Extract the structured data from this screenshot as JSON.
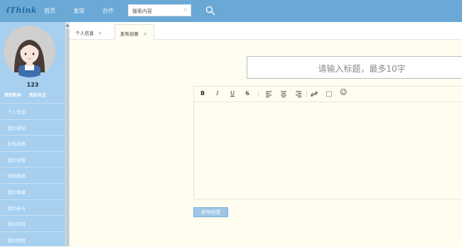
{
  "header": {
    "logo": "iThink",
    "nav": [
      "首页",
      "发现",
      "合作"
    ],
    "search": {
      "value": "搜索内容",
      "clear": "×"
    }
  },
  "sidebar": {
    "username": "123",
    "links": [
      "我的粉丝",
      "我的关注"
    ],
    "items": [
      "个人信息",
      "我的通知",
      "发布创意",
      "我的创意",
      "创意数据",
      "我的收藏",
      "我的参与",
      "获利项目",
      "我的团组"
    ]
  },
  "tabs": [
    {
      "label": "个人信息",
      "close": "×"
    },
    {
      "label": "发布创意",
      "close": "×"
    }
  ],
  "editor": {
    "title_placeholder": "请输入标题，最多10字",
    "toolbar": {
      "bold": "B",
      "italic": "I",
      "underline": "U",
      "strike": "S",
      "emoji": "☺"
    }
  },
  "publish_button": "发布创意",
  "colors": {
    "header": "#6aa8d6",
    "sidebar": "#a6cff0",
    "content_bg": "#fefdf0",
    "button": "#9ec6e6"
  }
}
